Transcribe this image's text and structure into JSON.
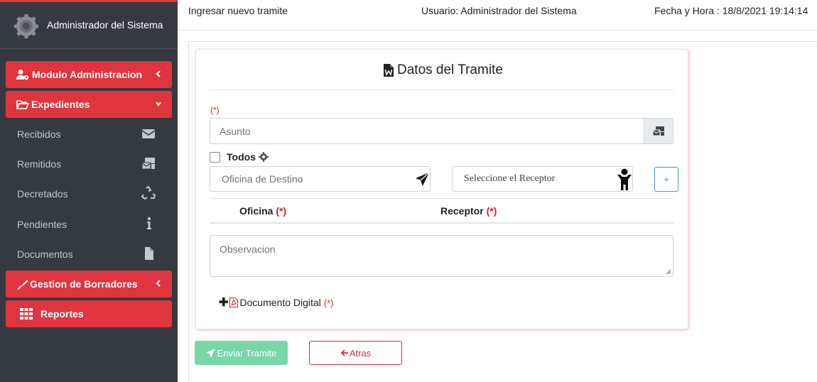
{
  "sidebar": {
    "brand_name": "Administrador del Sistema",
    "modulo_admin": "Modulo Administracion",
    "expedientes": "Expedientes",
    "items": [
      {
        "label": "Recibidos",
        "icon": "envelope-icon"
      },
      {
        "label": "Remitidos",
        "icon": "mail-bulk-icon"
      },
      {
        "label": "Decretados",
        "icon": "recycle-icon"
      },
      {
        "label": "Pendientes",
        "icon": "info-icon"
      },
      {
        "label": "Documentos",
        "icon": "file-icon"
      }
    ],
    "gestion_borradores": "Gestion de Borradores",
    "reportes": "Reportes"
  },
  "header": {
    "page_title": "Ingresar nuevo tramite",
    "usuario": "Usuario: Administrador del Sistema",
    "fecha_hora": "Fecha y Hora : 18/8/2021 19:14:14"
  },
  "form": {
    "title": "Datos del Tramite",
    "required_mark": "(*)",
    "asunto_placeholder": "Asunto",
    "todos_label": "Todos",
    "oficina_placeholder": "Oficina de Destino",
    "receptor_placeholder": "Seleccione el Receptor",
    "add_label": "+",
    "table_headers": {
      "oficina": "Oficina",
      "receptor": "Receptor"
    },
    "observacion_placeholder": "Observacion",
    "documento_label": "Documento Digital",
    "enviar_label": "Enviar Tramite",
    "atras_label": "Atras"
  },
  "colors": {
    "sidebar_bg": "#343a40",
    "accent_red": "#e0343f",
    "success_light": "#79d6a6",
    "info_blue": "#4a90d9"
  }
}
